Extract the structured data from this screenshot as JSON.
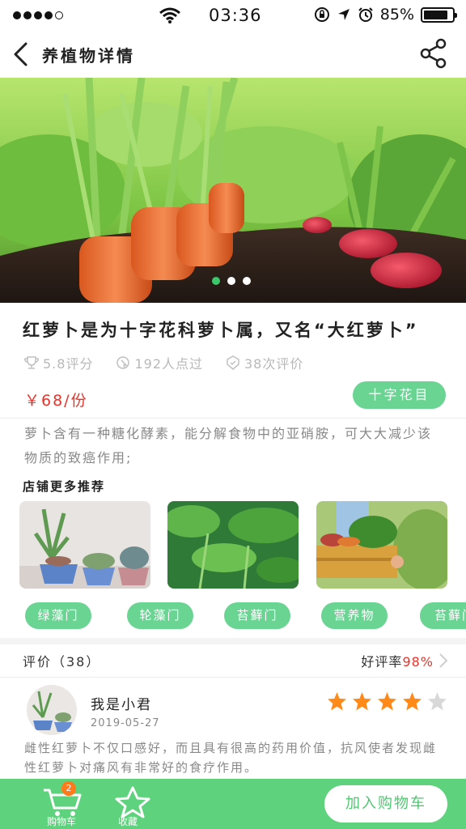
{
  "status_bar": {
    "time": "03:36",
    "battery": "85%",
    "battery_level": 0.85
  },
  "nav": {
    "title": "养植物详情"
  },
  "hero": {
    "slide_count": 3,
    "active_slide": 1
  },
  "product": {
    "title": "红萝卜是为十字花科萝卜属，又名“大红萝卜”",
    "rating": "5.8评分",
    "likes": "192人点过",
    "review_count_text": "38次评价",
    "price": "￥68/份",
    "category_tag": "十字花目",
    "description": "萝卜含有一种糖化酵素，能分解食物中的亚硝胺，可大大减少该物质的致癌作用;"
  },
  "recommendations": {
    "heading": "店铺更多推荐",
    "tags": [
      "绿藻门",
      "轮藻门",
      "苔藓门",
      "营养物",
      "苔藓门"
    ]
  },
  "reviews": {
    "label": "评价（38）",
    "rating_label": "好评率",
    "rating_value": "98%",
    "item": {
      "name": "我是小君",
      "date": "2019-05-27",
      "stars": 4,
      "max_stars": 5,
      "text": "雌性红萝卜不仅口感好，而且具有很高的药用价值，抗风使者发现雌性红萝卜对痛风有非常好的食疗作用。"
    }
  },
  "bottom_bar": {
    "cart_badge": "2",
    "cart_label": "购物车",
    "fav_label": "收藏",
    "add_to_cart": "加入购物车"
  },
  "colors": {
    "accent": "#5fd27e",
    "price": "#e8332a",
    "star": "#ff8a1a"
  }
}
